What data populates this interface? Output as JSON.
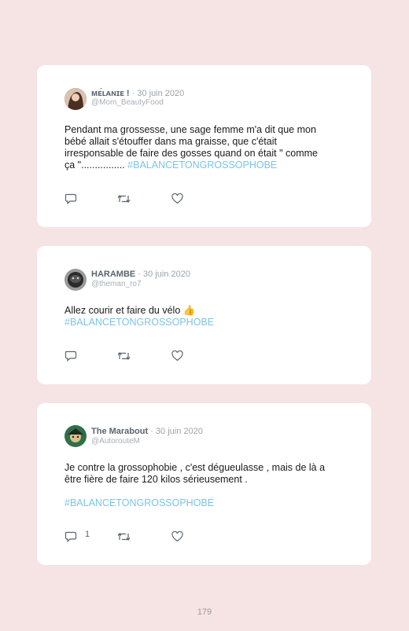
{
  "tweets": [
    {
      "name": "ᴍᴇ́ʟᴀɴɪᴇ !",
      "date": "· 30 juin 2020",
      "handle": "@Mom_BeautyFood",
      "lines": [
        "Pendant ma grossesse, une sage femme m'a dit que mon",
        "bébé allait s'étouffer dans ma graisse, que c'était",
        "irresponsable de faire des gosses quand on était \" comme",
        "ça \"................"
      ],
      "hashtag": "#BALANCETONGROSSOPHOBE",
      "reply_count": ""
    },
    {
      "name": "HARAMBE",
      "date": "· 30 juin 2020",
      "handle": "@theman_ro7",
      "lines": [
        "Allez courir et faire du vélo 👍"
      ],
      "hashtag": "#BALANCETONGROSSOPHOBE",
      "reply_count": ""
    },
    {
      "name": "The Marabout",
      "date": "· 30 juin 2020",
      "handle": "@AutorouteM",
      "lines": [
        "Je contre la grossophobie , c'est dégueulasse , mais de là a",
        "être fière de faire 120 kilos sérieusement ."
      ],
      "hashtag": "#BALANCETONGROSSOPHOBE",
      "reply_count": "1"
    }
  ],
  "icons": {
    "reply": "reply-icon",
    "retweet": "retweet-icon",
    "like": "heart-icon"
  },
  "colors": {
    "background": "#f6e3e4",
    "card": "#ffffff",
    "hashtag": "#7cc3e6"
  },
  "page_number": "179"
}
